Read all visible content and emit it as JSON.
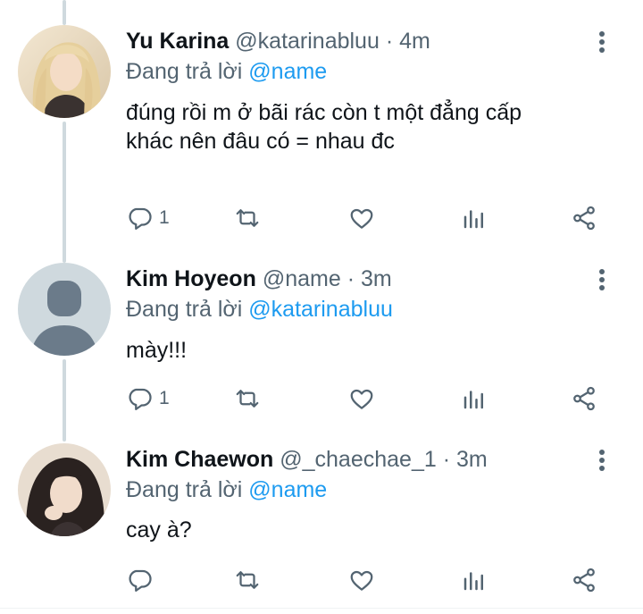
{
  "colors": {
    "link": "#1d9bf0",
    "secondary": "#536471",
    "text": "#0f1419",
    "thread_line": "#cfd9de"
  },
  "replies": [
    {
      "name": "Yu Karina",
      "handle": "@katarinabluu",
      "time": "4m",
      "replying_label": "Đang trả lời",
      "replying_to": "@name",
      "text_lines": [
        "đúng rồi m ở bãi rác còn t một đẳng cấp",
        "khác nên đâu có = nhau đc"
      ],
      "reply_count": "1",
      "avatar": "photo-blonde"
    },
    {
      "name": "Kim Hoyeon",
      "handle": "@name",
      "time": "3m",
      "replying_label": "Đang trả lời",
      "replying_to": "@katarinabluu",
      "text_lines": [
        "mày!!!"
      ],
      "reply_count": "1",
      "avatar": "default-avatar"
    },
    {
      "name": "Kim Chaewon",
      "handle": "@_chaechae_1",
      "time": "3m",
      "replying_label": "Đang trả lời",
      "replying_to": "@name",
      "text_lines": [
        "cay à?"
      ],
      "reply_count": "",
      "avatar": "photo-dark-hair"
    }
  ],
  "separator": "·",
  "icons": [
    "reply-icon",
    "retweet-icon",
    "like-icon",
    "analytics-icon",
    "share-icon",
    "more-icon"
  ]
}
